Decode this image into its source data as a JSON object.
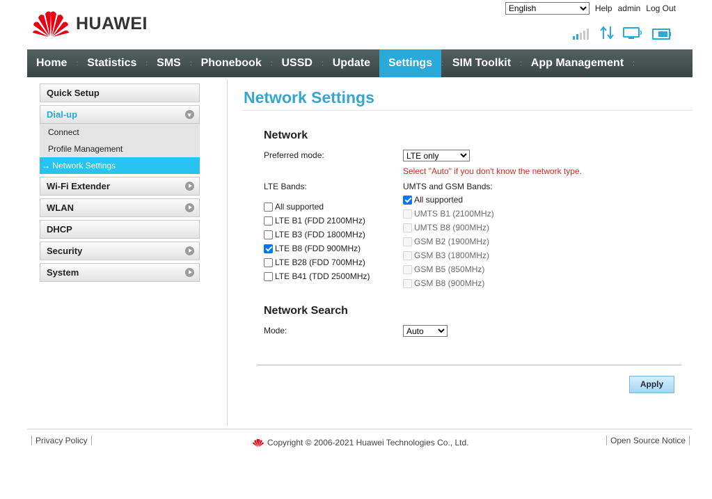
{
  "topbar": {
    "language": "English",
    "help": "Help",
    "user": "admin",
    "logout": "Log Out"
  },
  "brand": {
    "name": "HUAWEI",
    "color": "#e60012"
  },
  "status_icons": [
    "signal-icon",
    "data-transfer-icon",
    "computer-connection-icon",
    "battery-icon"
  ],
  "nav": {
    "items": [
      {
        "label": "Home"
      },
      {
        "label": "Statistics"
      },
      {
        "label": "SMS"
      },
      {
        "label": "Phonebook"
      },
      {
        "label": "USSD"
      },
      {
        "label": "Update"
      },
      {
        "label": "Settings",
        "active": true
      },
      {
        "label": "SIM Toolkit"
      },
      {
        "label": "App Management"
      }
    ],
    "active_color": "#28a9d9"
  },
  "sidebar": {
    "quick_setup": "Quick Setup",
    "dialup": "Dial-up",
    "dialup_sub": [
      "Connect",
      "Profile Management",
      "Network Settings"
    ],
    "wifi_extender": "Wi-Fi Extender",
    "wlan": "WLAN",
    "dhcp": "DHCP",
    "security": "Security",
    "system": "System"
  },
  "main": {
    "title": "Network Settings",
    "network_title": "Network",
    "preferred_mode_label": "Preferred mode:",
    "preferred_mode_value": "LTE only",
    "hint": "Select \"Auto\" if you don't know the network type.",
    "lte_bands_label": "LTE Bands:",
    "umts_gsm_label": "UMTS and GSM Bands:",
    "lte_bands": [
      {
        "label": "All supported",
        "checked": false
      },
      {
        "label": "LTE B1 (FDD 2100MHz)",
        "checked": false
      },
      {
        "label": "LTE B3 (FDD 1800MHz)",
        "checked": false
      },
      {
        "label": "LTE B8 (FDD 900MHz)",
        "checked": true
      },
      {
        "label": "LTE B28 (FDD 700MHz)",
        "checked": false
      },
      {
        "label": "LTE B41 (TDD 2500MHz)",
        "checked": false
      }
    ],
    "umts_gsm_bands": [
      {
        "label": "All supported",
        "checked": true,
        "disabled": false
      },
      {
        "label": "UMTS B1 (2100MHz)",
        "checked": false,
        "disabled": true
      },
      {
        "label": "UMTS B8 (900MHz)",
        "checked": false,
        "disabled": true
      },
      {
        "label": "GSM B2 (1900MHz)",
        "checked": false,
        "disabled": true
      },
      {
        "label": "GSM B3 (1800MHz)",
        "checked": false,
        "disabled": true
      },
      {
        "label": "GSM B5 (850MHz)",
        "checked": false,
        "disabled": true
      },
      {
        "label": "GSM B8 (900MHz)",
        "checked": false,
        "disabled": true
      }
    ],
    "search_title": "Network Search",
    "mode_label": "Mode:",
    "mode_value": "Auto",
    "apply": "Apply"
  },
  "footer": {
    "privacy": "Privacy Policy",
    "copyright": "Copyright © 2006-2021 Huawei Technologies Co., Ltd.",
    "open_source": "Open Source Notice"
  }
}
